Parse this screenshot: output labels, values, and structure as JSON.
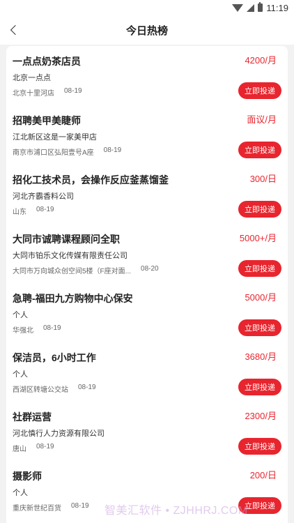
{
  "status_bar": {
    "time": "11:19",
    "icons": [
      "wifi-icon",
      "signal-icon",
      "battery-icon"
    ]
  },
  "header": {
    "title": "今日热榜",
    "back_icon": "chevron-left-icon"
  },
  "apply_label": "立即投递",
  "jobs": [
    {
      "title": "一点点奶茶店员",
      "salary": "4200/月",
      "company": "北京一点点",
      "location": "北京十里河店",
      "date": "08-19"
    },
    {
      "title": "招聘美甲美睫师",
      "salary": "面议/月",
      "company": "江北新区这是一家美甲店",
      "location": "南京市浦口区弘阳壹号A座",
      "date": "08-19"
    },
    {
      "title": "招化工技术员，会操作反应釜蒸馏釜",
      "salary": "300/日",
      "company": "河北齐霸香料公司",
      "location": "山东",
      "date": "08-19"
    },
    {
      "title": "大同市诚聘课程顾问全职",
      "salary": "5000+/月",
      "company": "大同市铂乐文化传媒有限责任公司",
      "location": "大同市万向城众创空间5楼（F座对面...",
      "date": "08-20"
    },
    {
      "title": "急聘-福田九方购物中心保安",
      "salary": "5000/月",
      "company": "个人",
      "location": "华强北",
      "date": "08-19"
    },
    {
      "title": "保洁员，6小时工作",
      "salary": "3680/月",
      "company": "个人",
      "location": "西湖区转塘公交站",
      "date": "08-19"
    },
    {
      "title": "社群运营",
      "salary": "2300/月",
      "company": "河北慎行人力资源有限公司",
      "location": "唐山",
      "date": "08-19"
    },
    {
      "title": "摄影师",
      "salary": "200/日",
      "company": "个人",
      "location": "重庆新世纪百货",
      "date": "08-19"
    }
  ],
  "watermark": "智美汇软件 • ZJHHRJ.COM",
  "colors": {
    "accent": "#e8252e",
    "background": "#f2f2f2",
    "card": "#ffffff"
  }
}
